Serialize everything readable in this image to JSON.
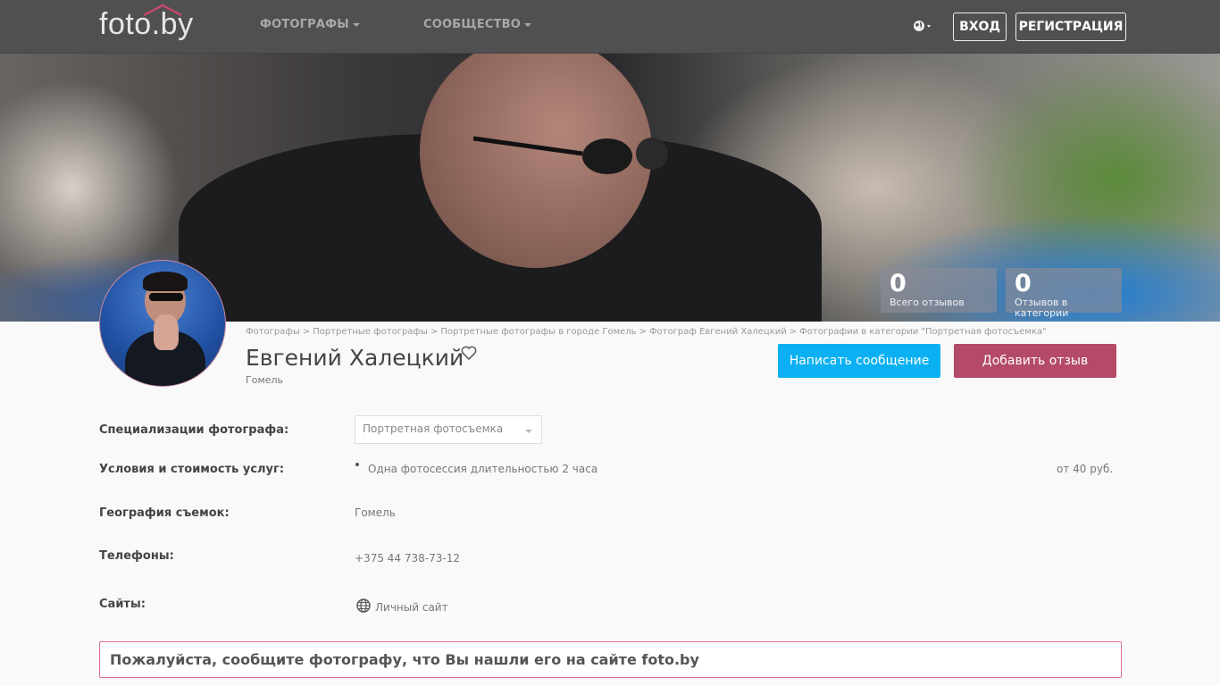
{
  "header": {
    "logo": "foto.by",
    "nav": [
      {
        "label": "ФОТОГРАФЫ"
      },
      {
        "label": "СООБЩЕСТВО"
      }
    ],
    "login": "ВХОД",
    "register": "РЕГИСТРАЦИЯ"
  },
  "stats": [
    {
      "value": "0",
      "label": "Всего отзывов"
    },
    {
      "value": "0",
      "label": "Отзывов в категории"
    }
  ],
  "breadcrumb": [
    "Фотографы",
    "Портретные фотографы",
    "Портретные фотографы в городе Гомель",
    "Фотограф Евгений Халецкий",
    "Фотографии в категории \"Портретная фотосъемка\""
  ],
  "profile": {
    "name": "Евгений Халецкий",
    "city": "Гомель",
    "message_button": "Написать сообщение",
    "review_button": "Добавить отзыв"
  },
  "info": {
    "specializations_label": "Специализации фотографа:",
    "specialization_selected": "Портретная фотосъемка",
    "services_label": "Условия и стоимость услуг:",
    "service_item": "Одна фотосессия длительностью 2 часа",
    "service_price": "от 40 руб.",
    "geo_label": "География съемок:",
    "geo_value": "Гомель",
    "phones_label": "Телефоны:",
    "phone_value": "+375 44 738-73-12",
    "sites_label": "Сайты:",
    "site_value": "Личный сайт"
  },
  "notice": "Пожалуйста, сообщите фотографу, что Вы нашли его на сайте foto.by",
  "colors": {
    "header_bg": "#505050",
    "primary_blue": "#0ab0f2",
    "review_red": "#b44a68",
    "notice_border": "#e06f86"
  }
}
